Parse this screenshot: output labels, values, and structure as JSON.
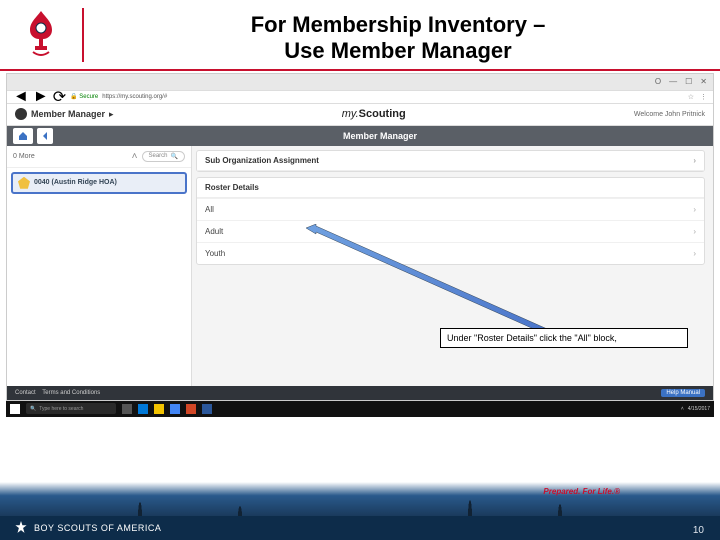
{
  "title_line1": "For Membership Inventory –",
  "title_line2": "Use Member Manager",
  "browser": {
    "window_o": "O",
    "secure": "Secure",
    "url": "https://my.scouting.org/#",
    "tab": "my.scouting.org"
  },
  "app": {
    "topbar_label": "Member Manager",
    "brand_prefix": "my.",
    "brand_bold": "Scouting",
    "welcome": "Welcome John Pritnick",
    "subhead_title": "Member Manager"
  },
  "left": {
    "more": "0 More",
    "search": "Search",
    "org": "0040 (Austin Ridge HOA)"
  },
  "right": {
    "sub_org": "Sub Organization Assignment",
    "roster_details": "Roster Details",
    "rows": {
      "all": "All",
      "adult": "Adult",
      "youth": "Youth"
    }
  },
  "callout": "Under \"Roster Details\" click the \"All\" block,",
  "app_footer": {
    "contact": "Contact",
    "terms": "Terms and Conditions",
    "help": "Help Manual"
  },
  "taskbar": {
    "search": "Type here to search",
    "time": "4/15/2017"
  },
  "tagline": "Prepared. For Life.®",
  "footer_brand": "BOY SCOUTS OF AMERICA",
  "page_num": "10"
}
